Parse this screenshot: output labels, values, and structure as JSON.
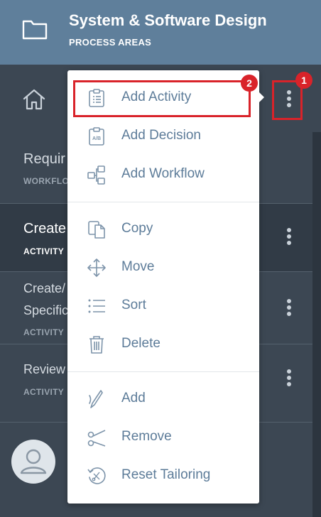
{
  "header": {
    "title": "System & Software Design",
    "subtitle": "PROCESS AREAS"
  },
  "rows": [
    {
      "label": "Requir",
      "sub": "WORKFLO"
    },
    {
      "label": "Create",
      "sub": "ACTIVITY"
    },
    {
      "label1": "Create/",
      "label2": "Specific",
      "sub": "ACTIVITY"
    },
    {
      "label": "Review",
      "sub": "ACTIVITY"
    }
  ],
  "menu": {
    "groups": [
      [
        {
          "label": "Add Activity",
          "icon": "clipboard-list-icon"
        },
        {
          "label": "Add Decision",
          "icon": "clipboard-ab-icon"
        },
        {
          "label": "Add Workflow",
          "icon": "workflow-icon"
        }
      ],
      [
        {
          "label": "Copy",
          "icon": "copy-icon"
        },
        {
          "label": "Move",
          "icon": "move-icon"
        },
        {
          "label": "Sort",
          "icon": "sort-list-icon"
        },
        {
          "label": "Delete",
          "icon": "trash-icon"
        }
      ],
      [
        {
          "label": "Add",
          "icon": "pen-nib-icon"
        },
        {
          "label": "Remove",
          "icon": "scissors-icon"
        },
        {
          "label": "Reset Tailoring",
          "icon": "reset-tailoring-icon"
        }
      ]
    ]
  },
  "annotations": {
    "badge1": "1",
    "badge2": "2"
  },
  "colors": {
    "header": "#5f7f9b",
    "menu_text": "#5d7c99",
    "highlight": "#d9232a",
    "sidebar": "#3c4753"
  }
}
